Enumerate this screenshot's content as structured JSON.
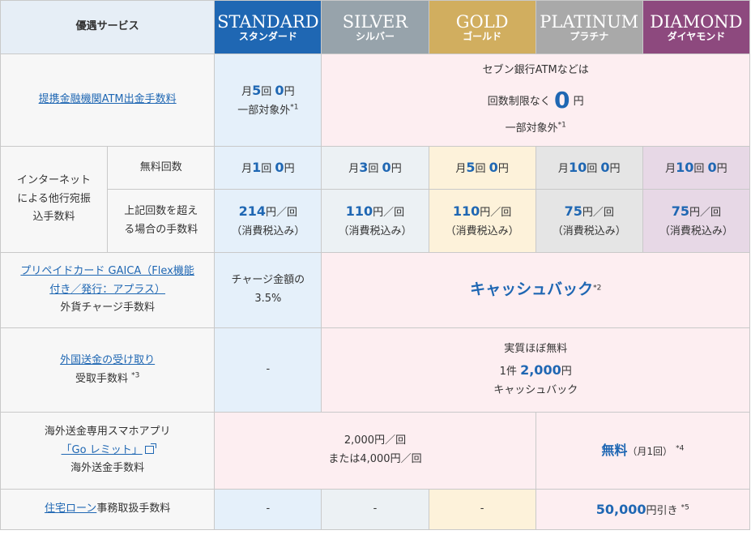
{
  "header": {
    "service_label": "優遇サービス",
    "tiers": [
      {
        "en": "STANDARD",
        "jp": "スタンダード"
      },
      {
        "en": "SILVER",
        "jp": "シルバー"
      },
      {
        "en": "GOLD",
        "jp": "ゴールド"
      },
      {
        "en": "PLATINUM",
        "jp": "プラチナ"
      },
      {
        "en": "DIAMOND",
        "jp": "ダイヤモンド"
      }
    ]
  },
  "atm": {
    "label": "提携金融機関ATM出金手数料",
    "standard": {
      "pre": "月",
      "count": "5",
      "unit": "回",
      "fee": "0",
      "yen": "円",
      "note": "一部対象外",
      "mark": "*1"
    },
    "others": {
      "line1": "セブン銀行ATMなどは",
      "line2_pre": "回数制限なく",
      "zero": "0",
      "yen": "円",
      "note": "一部対象外",
      "mark": "*1"
    }
  },
  "transfer": {
    "group_label": [
      "インターネット",
      "による他行宛振",
      "込手数料"
    ],
    "free_label": "無料回数",
    "fee_label": [
      "上記回数を超え",
      "る場合の手数料"
    ],
    "free_counts": [
      {
        "pre": "月",
        "count": "1",
        "unit": "回",
        "fee": "0",
        "yen": "円"
      },
      {
        "pre": "月",
        "count": "3",
        "unit": "回",
        "fee": "0",
        "yen": "円"
      },
      {
        "pre": "月",
        "count": "5",
        "unit": "回",
        "fee": "0",
        "yen": "円"
      },
      {
        "pre": "月",
        "count": "10",
        "unit": "回",
        "fee": "0",
        "yen": "円"
      },
      {
        "pre": "月",
        "count": "10",
        "unit": "回",
        "fee": "0",
        "yen": "円"
      }
    ],
    "fees": [
      {
        "amount": "214",
        "unit": "円／回",
        "tax": "（消費税込み）"
      },
      {
        "amount": "110",
        "unit": "円／回",
        "tax": "（消費税込み）"
      },
      {
        "amount": "110",
        "unit": "円／回",
        "tax": "（消費税込み）"
      },
      {
        "amount": "75",
        "unit": "円／回",
        "tax": "（消費税込み）"
      },
      {
        "amount": "75",
        "unit": "円／回",
        "tax": "（消費税込み）"
      }
    ]
  },
  "gaica": {
    "link1": "プリペイドカード GAICA（Flex機能",
    "link2": "付き／発行：アプラス）",
    "label": "外貨チャージ手数料",
    "standard1": "チャージ金額の",
    "standard2": "3.5%",
    "cashback": "キャッシュバック",
    "mark": "*2"
  },
  "remit_in": {
    "link": "外国送金の受け取り",
    "label": "受取手数料",
    "mark": "*3",
    "standard": "-",
    "line1": "実質ほぼ無料",
    "pre": "1件",
    "amount": "2,000",
    "yen": "円",
    "line3": "キャッシュバック"
  },
  "go_remit": {
    "line1": "海外送金専用スマホアプリ",
    "link": "「Go レミット」",
    "label": "海外送金手数料",
    "fee1": "2,000円／回",
    "fee2": "または4,000円／回",
    "free": "無料",
    "free_note": "（月1回）",
    "mark": "*4"
  },
  "mortgage": {
    "link": "住宅ローン",
    "label_rest": "事務取扱手数料",
    "standard": "-",
    "silver": "-",
    "gold": "-",
    "amount": "50,000",
    "suffix": "円引き",
    "mark": "*5"
  }
}
